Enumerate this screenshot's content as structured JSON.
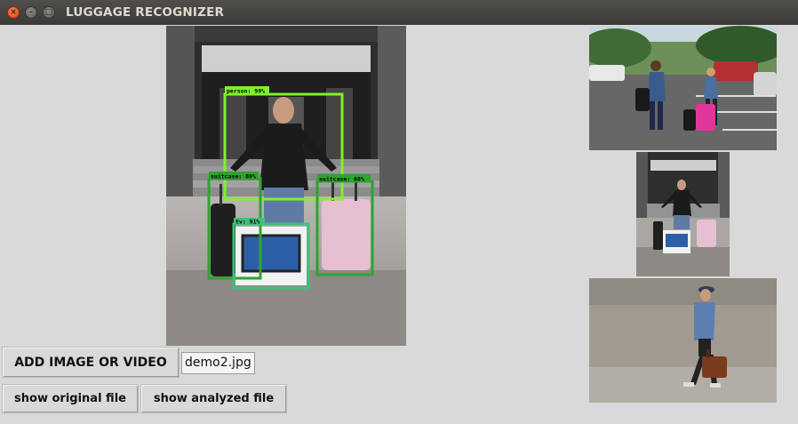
{
  "window": {
    "title": "LUGGAGE RECOGNIZER",
    "close_glyph": "×",
    "minimize_glyph": "–",
    "maximize_glyph": "□"
  },
  "main_image": {
    "detections": [
      {
        "label": "person: 99%",
        "color": "#7cf32a"
      },
      {
        "label": "suitcase: 89%",
        "color": "#2fa32f"
      },
      {
        "label": "suitcase: 68%",
        "color": "#2fa32f"
      },
      {
        "label": "tv: 91%",
        "color": "#3ec07a"
      }
    ]
  },
  "controls": {
    "add_button": "ADD IMAGE OR VIDEO",
    "file_name": "demo2.jpg",
    "show_original": "show original file",
    "show_analyzed": "show analyzed file"
  },
  "colors": {
    "background": "#d9d9d9",
    "titlebar": "#3c3b37",
    "close_button": "#e05a2a"
  }
}
